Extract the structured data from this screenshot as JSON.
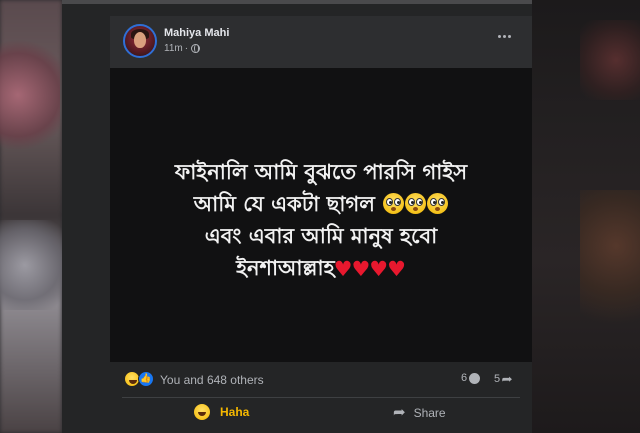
{
  "post": {
    "author": "Mahiya Mahi",
    "time": "11m",
    "privacy_icon": "globe-icon",
    "menu_icon": "more-dots-icon",
    "lines": [
      "ফাইনালি আমি বুঝতে পারসি গাইস",
      "আমি যে একটা ছাগল",
      "এবং এবার আমি মানুষ হবো",
      "ইনশাআল্লাহ"
    ],
    "emojis": {
      "line2": "flushed-face",
      "line4": "red-heart"
    }
  },
  "reactions": {
    "summary": "You and 648 others",
    "icons": [
      "haha-icon",
      "like-icon"
    ],
    "comments_count": "6",
    "shares_count": "5"
  },
  "actions": {
    "reacted_label": "Haha",
    "share_label": "Share"
  },
  "colors": {
    "haha_accent": "#f5b800",
    "heart": "#e8182e",
    "like_blue": "#1877f2",
    "card_bg": "#242526",
    "body_bg": "#111112"
  }
}
